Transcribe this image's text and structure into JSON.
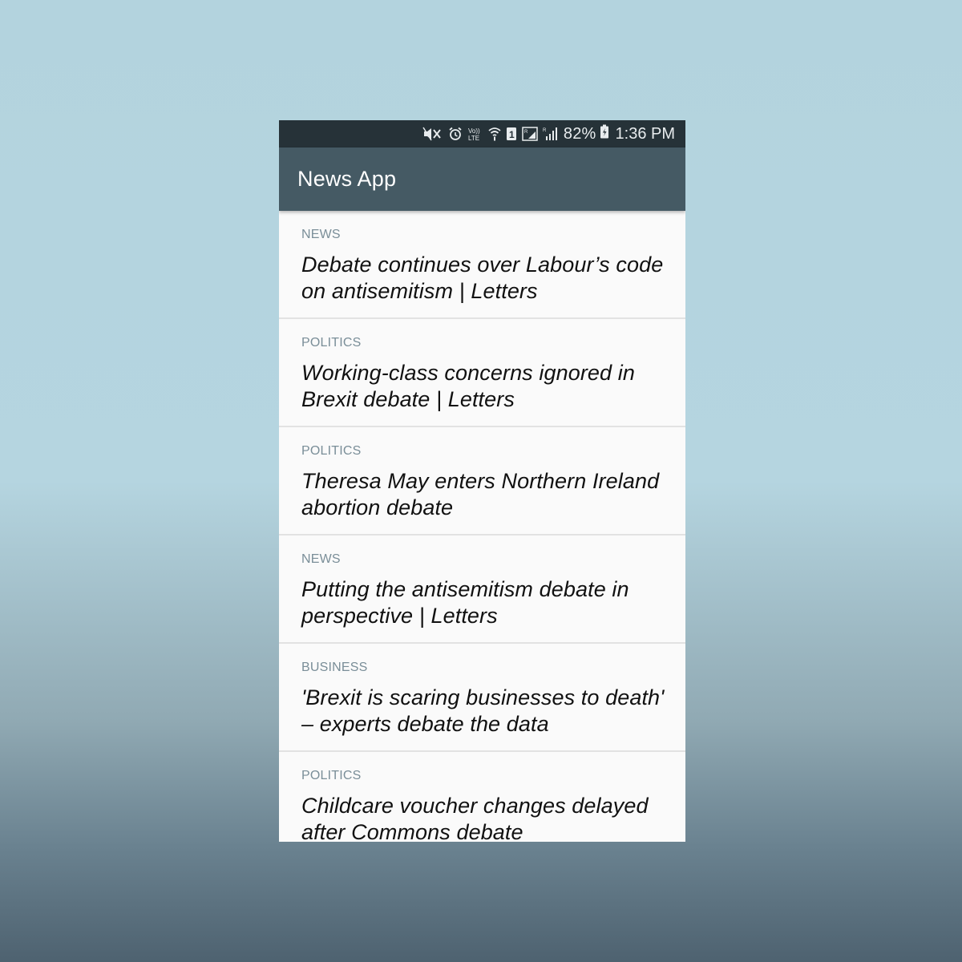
{
  "status_bar": {
    "battery_percent": "82%",
    "time": "1:36 PM",
    "icons": [
      "mute-icon",
      "alarm-icon",
      "volte-icon",
      "wifi-icon",
      "sim-1-icon",
      "nfc-icon",
      "signal-icon",
      "battery-icon"
    ]
  },
  "app_bar": {
    "title": "News App"
  },
  "articles": [
    {
      "category": "NEWS",
      "title": "Debate continues over Labour’s code on antisemitism | Letters"
    },
    {
      "category": "POLITICS",
      "title": "Working-class concerns ignored in Brexit debate | Letters"
    },
    {
      "category": "POLITICS",
      "title": "Theresa May enters Northern Ireland abortion debate"
    },
    {
      "category": "NEWS",
      "title": "Putting the antisemitism debate in perspective | Letters"
    },
    {
      "category": "BUSINESS",
      "title": "'Brexit is scaring businesses to death' –  experts debate the data"
    },
    {
      "category": "POLITICS",
      "title": "Childcare voucher changes delayed after Commons debate"
    }
  ],
  "colors": {
    "status_bar": "#263238",
    "app_bar": "#455a64",
    "category_text": "#7a8e98",
    "list_background": "#fafafa"
  }
}
